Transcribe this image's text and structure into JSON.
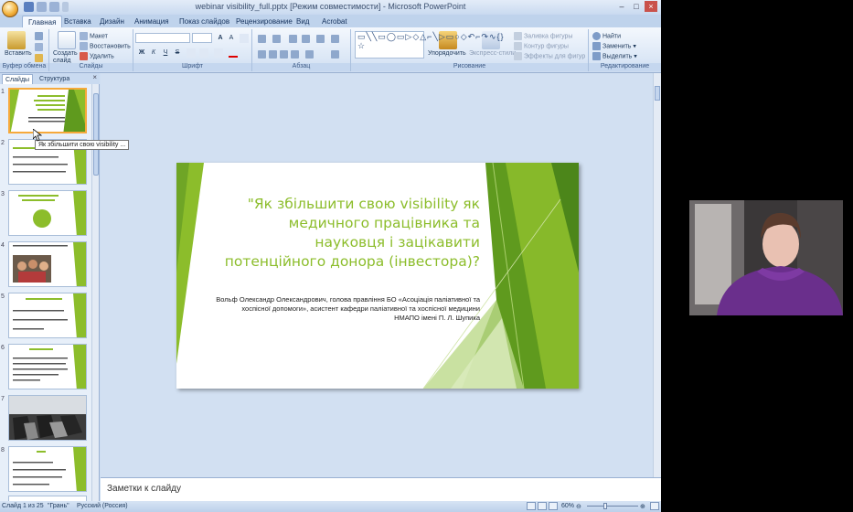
{
  "window": {
    "title": "webinar visibility_full.pptx [Режим совместимости] - Microsoft PowerPoint",
    "controls": [
      "–",
      "□",
      "×"
    ]
  },
  "ribbon_tabs": [
    "Главная",
    "Вставка",
    "Дизайн",
    "Анимация",
    "Показ слайдов",
    "Рецензирование",
    "Вид",
    "Acrobat"
  ],
  "ribbon": {
    "clipboard": {
      "paste": "Вставить",
      "label": "Буфер обмена"
    },
    "slides": {
      "new_slide": "Создать слайд",
      "layout": "Макет",
      "reset": "Восстановить",
      "delete": "Удалить",
      "label": "Слайды"
    },
    "font": {
      "label": "Шрифт",
      "bold": "Ж",
      "italic": "К",
      "underline": "Ч",
      "strike": "S",
      "grow": "A",
      "shrink": "A"
    },
    "paragraph": {
      "label": "Абзац"
    },
    "drawing": {
      "shapes_glyphs": "▭╲╲▭◯▭▷◇△⌐╲▷▭○◇↶⌐↷∿{}☆",
      "arrange": "Упорядочить",
      "quick_styles": "Экспресс-стили",
      "fill": "Заливка фигуры",
      "outline": "Контур фигуры",
      "effects": "Эффекты для фигур",
      "label": "Рисование"
    },
    "editing": {
      "find": "Найти",
      "replace": "Заменить",
      "select": "Выделить",
      "label": "Редактирование"
    }
  },
  "slides_pane": {
    "tabs": [
      "Слайды",
      "Структура"
    ],
    "close": "×",
    "tooltip": "Як збільшити свою visibility ...",
    "thumbnails": [
      1,
      2,
      3,
      4,
      5,
      6,
      7,
      8
    ]
  },
  "slide": {
    "title": "\"Як збільшити свою visibility як медичного працівника та науковця і зацікавити потенційного донора (інвестора)?",
    "subtitle": "Вольф Олександр Олександрович, голова правління БО «Асоціація паліативної та хоспісної допомоги», асистент кафедри паліативної та хоспісної медицини НМАПО імені П. Л. Шупика"
  },
  "notes": {
    "placeholder": "Заметки к слайду"
  },
  "status_bar": {
    "slide_info": "Слайд 1 из 25",
    "theme": "\"Грань\"",
    "language": "Русский (Россия)",
    "zoom": "60%"
  },
  "colors": {
    "accent_green": "#8cbd2b",
    "dark_green": "#5f9a1e",
    "ribbon_blue": "#cfdff2",
    "selection_orange": "#f6a93b"
  }
}
